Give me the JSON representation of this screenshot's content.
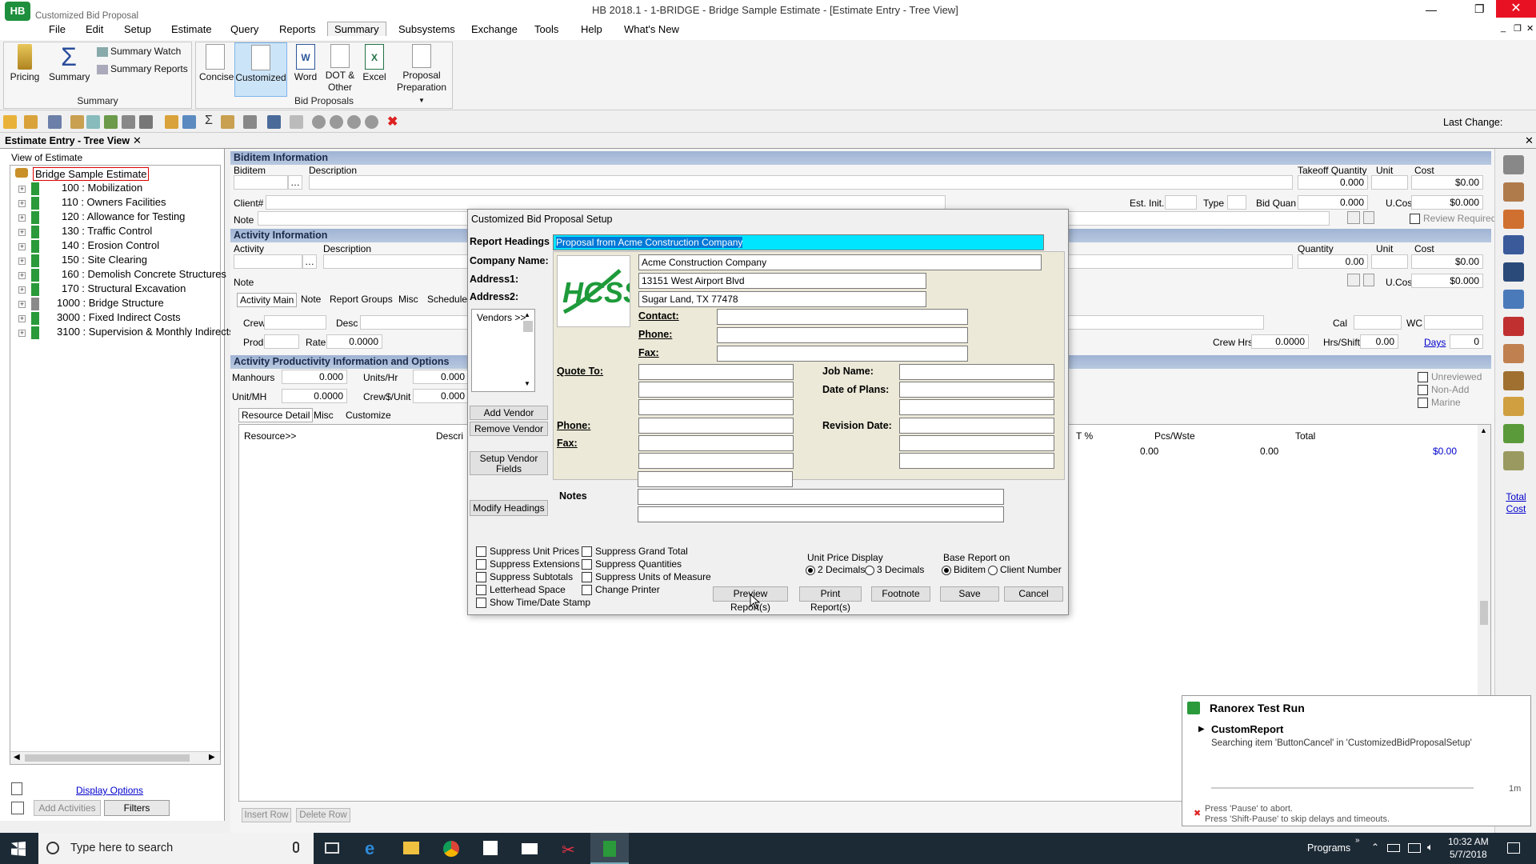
{
  "window": {
    "app_title": "Customized Bid Proposal",
    "title": "HB 2018.1 - 1-BRIDGE - Bridge Sample Estimate - [Estimate Entry - Tree View]"
  },
  "menu": [
    "File",
    "Edit",
    "Setup",
    "Estimate",
    "Query",
    "Reports",
    "Summary",
    "Subsystems",
    "Exchange",
    "Tools",
    "Help",
    "What's New"
  ],
  "ribbon": {
    "pricing": "Pricing",
    "summary": "Summary",
    "summary_watch": "Summary Watch",
    "summary_reports": "Summary Reports",
    "summary_group": "Summary",
    "concise": "Concise",
    "customized": "Customized",
    "word": "Word",
    "dot_other": "DOT & Other",
    "excel": "Excel",
    "proposal_prep": "Proposal Preparation",
    "bid_group": "Bid Proposals"
  },
  "toolbar": {
    "last_change": "Last Change:"
  },
  "panel": {
    "tab": "Estimate Entry - Tree View",
    "view_label": "View of Estimate",
    "root": "Bridge Sample Estimate",
    "items": [
      "100 : Mobilization",
      "110 : Owners Facilities",
      "120 : Allowance for Testing",
      "130 : Traffic Control",
      "140 : Erosion Control",
      "150 : Site Clearing",
      "160 : Demolish Concrete Structures",
      "170 : Structural Excavation",
      "1000 : Bridge Structure",
      "3000 : Fixed Indirect  Costs",
      "3100 : Supervision & Monthly Indirects"
    ],
    "display_options": "Display Options",
    "add_activities": "Add Activities",
    "filters": "Filters"
  },
  "biditem": {
    "header": "Biditem Information",
    "biditem": "Biditem",
    "description": "Description",
    "takeoff_qty": "Takeoff Quantity",
    "unit": "Unit",
    "cost": "Cost",
    "takeoff_val": "0.000",
    "cost_val": "$0.00",
    "client": "Client#",
    "est_init": "Est. Init.",
    "type": "Type",
    "bid_quan": "Bid Quan",
    "bid_quan_val": "0.000",
    "ucost": "U.Cost",
    "ucost_val": "$0.000",
    "note": "Note",
    "review_required": "Review Required"
  },
  "activity": {
    "header": "Activity Information",
    "activity": "Activity",
    "description": "Description",
    "quantity": "Quantity",
    "unit": "Unit",
    "cost": "Cost",
    "qty_val": "0.00",
    "cost_val": "$0.00",
    "ucost": "U.Cost",
    "ucost_val": "$0.000",
    "note": "Note",
    "tabs": [
      "Activity Main",
      "Note",
      "Report Groups",
      "Misc",
      "Schedule A"
    ],
    "crew": "Crew",
    "desc": "Desc",
    "cal": "Cal",
    "wc": "WC",
    "prod": "Prod",
    "rate": "Rate",
    "rate_val": "0.0000",
    "crew_hrs": "Crew Hrs",
    "crew_hrs_val": "0.0000",
    "hrs_shift": "Hrs/Shift",
    "hrs_shift_val": "0.00",
    "days": "Days",
    "days_val": "0"
  },
  "productivity": {
    "header": "Activity Productivity Information and Options",
    "manhours": "Manhours",
    "manhours_val": "0.000",
    "units_hr": "Units/Hr",
    "units_hr_val": "0.000",
    "unit_mh": "Unit/MH",
    "unit_mh_val": "0.0000",
    "crew_unit": "Crew$/Unit",
    "crew_unit_val": "0.000",
    "unreviewed": "Unreviewed",
    "non_add": "Non-Add",
    "marine": "Marine",
    "tabs": [
      "Resource Detail",
      "Misc",
      "Customize"
    ],
    "col_resource": "Resource>>",
    "col_descr": "Descri",
    "col_t": "T %",
    "col_pcs": "Pcs/Wste",
    "col_total": "Total",
    "val_a": "0.00",
    "val_b": "0.00",
    "val_total": "$0.00",
    "insert_row": "Insert Row",
    "delete_row": "Delete Row"
  },
  "right": {
    "total_cost": "Total Cost"
  },
  "dialog": {
    "title": "Customized Bid Proposal Setup",
    "report_headings": "Report Headings",
    "report_headings_val": "Proposal from Acme Construction Company",
    "company_name": "Company Name:",
    "address1": "Address1:",
    "address2": "Address2:",
    "company_val": "Acme Construction Company",
    "address1_val": "13151 West Airport Blvd",
    "address2_val": "Sugar Land, TX 77478",
    "logo_text": "HCSS",
    "contact": "Contact:",
    "phone": "Phone:",
    "fax": "Fax:",
    "vendors": "Vendors >>",
    "quote_to": "Quote To:",
    "job_name": "Job Name:",
    "date_of_plans": "Date of Plans:",
    "phone2": "Phone:",
    "revision_date": "Revision Date:",
    "fax2": "Fax:",
    "notes": "Notes",
    "add_vendor": "Add Vendor",
    "remove_vendor": "Remove Vendor",
    "setup_vendor": "Setup Vendor Fields",
    "modify_headings": "Modify Headings",
    "checks_left": [
      "Suppress Unit Prices",
      "Suppress Extensions",
      "Suppress Subtotals",
      "Letterhead Space",
      "Show Time/Date Stamp"
    ],
    "checks_right": [
      "Suppress Grand Total",
      "Suppress Quantities",
      "Suppress Units of Measure",
      "Change Printer"
    ],
    "unit_price_display": "Unit Price Display",
    "two_dec": "2 Decimals",
    "three_dec": "3 Decimals",
    "base_report": "Base Report on",
    "biditem": "Biditem",
    "client_number": "Client Number",
    "preview": "Preview Report(s)",
    "print": "Print Report(s)",
    "footnote": "Footnote",
    "save": "Save",
    "cancel": "Cancel"
  },
  "ranorex": {
    "title": "Ranorex Test Run",
    "item": "CustomReport",
    "message": "Searching item 'ButtonCancel' in 'CustomizedBidProposalSetup'",
    "time": "1m",
    "pause": "Press 'Pause' to abort.",
    "shift_pause": "Press 'Shift-Pause' to skip delays and timeouts."
  },
  "taskbar": {
    "search": "Type here to search",
    "programs": "Programs",
    "time": "10:32 AM",
    "date": "5/7/2018"
  },
  "colors": {
    "accent": "#00e5ff",
    "section": "#a9bdd9",
    "hcss_green": "#1e9a3a"
  }
}
